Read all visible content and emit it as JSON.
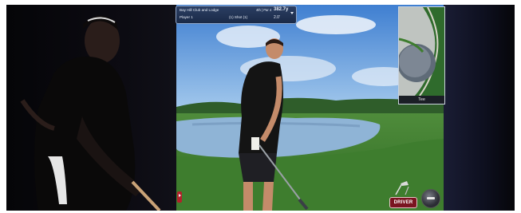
{
  "scene": {
    "description_hidden": "",
    "colors": {
      "sky": "#6aa6e0",
      "water": "#8fb4d6",
      "grass": "#4c8a35",
      "club_button": "#7a1420",
      "panel": "#1f3152"
    }
  },
  "info_box": {
    "course": "Bay Hill Club and Lodge",
    "player": "Player 1",
    "shot": "(1) Shot (1)",
    "range": "4th | Par 4",
    "yards": "382.7y",
    "height": "2.0'"
  },
  "minimap": {
    "label": "Tee"
  },
  "controls": {
    "club": "DRIVER"
  },
  "icons": {
    "dropdown": "chevron-down-icon",
    "club": "golf-club-icon",
    "swing": "swing-arrow-icon",
    "logo": "flag-logo-icon"
  }
}
